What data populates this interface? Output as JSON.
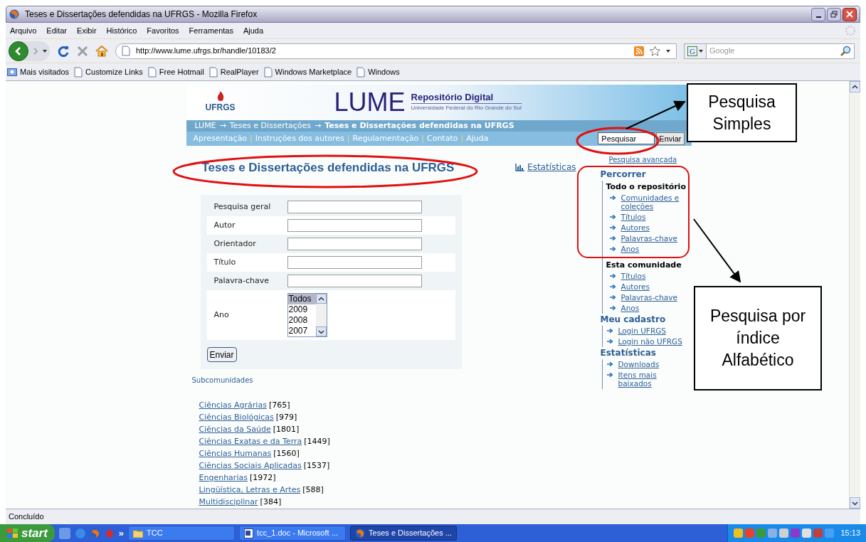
{
  "window": {
    "title": "Teses e Dissertações defendidas na UFRGS - Mozilla Firefox"
  },
  "menu": [
    "Arquivo",
    "Editar",
    "Exibir",
    "Histórico",
    "Favoritos",
    "Ferramentas",
    "Ajuda"
  ],
  "toolbar": {
    "url": "http://www.lume.ufrgs.br/handle/10183/2",
    "engine_logo": "G",
    "search_placeholder": "Google"
  },
  "bookmarks": [
    "Mais visitados",
    "Customize Links",
    "Free Hotmail",
    "RealPlayer",
    "Windows Marketplace",
    "Windows"
  ],
  "site": {
    "logo": "UFRGS",
    "brand": "LUME",
    "brand_title": "Repositório Digital",
    "brand_subtitle": "Universidade Federal do Rio Grande do Sul",
    "breadcrumb": [
      {
        "label": "LUME",
        "current": false
      },
      {
        "label": "Teses e Dissertações",
        "current": false
      },
      {
        "label": "Teses e Dissertações defendidas na UFRGS",
        "current": true
      }
    ],
    "breadcrumb_separator": "→",
    "nav": [
      "Apresentação",
      "Instruções dos autores",
      "Regulamentação",
      "Contato",
      "Ajuda"
    ],
    "nav_separator": "|",
    "search": {
      "value": "Pesquisar",
      "button": "Enviar",
      "advanced": "Pesquisa avançada"
    }
  },
  "main": {
    "title": "Teses e Dissertações defendidas na UFRGS",
    "stats_link": "Estatísticas",
    "form": {
      "fields": [
        {
          "label": "Pesquisa geral"
        },
        {
          "label": "Autor"
        },
        {
          "label": "Orientador"
        },
        {
          "label": "Título"
        },
        {
          "label": "Palavra-chave"
        }
      ],
      "year": {
        "label": "Ano",
        "options": [
          {
            "label": "Todos",
            "selected": true
          },
          {
            "label": "2009",
            "selected": false
          },
          {
            "label": "2008",
            "selected": false
          },
          {
            "label": "2007",
            "selected": false
          }
        ]
      },
      "submit": "Enviar"
    },
    "subcommunities": {
      "heading": "Subcomunidades",
      "items": [
        {
          "name": "Ciências Agrárias",
          "count": "[765]"
        },
        {
          "name": "Ciências Biológicas",
          "count": "[979]"
        },
        {
          "name": "Ciências da Saúde",
          "count": "[1801]"
        },
        {
          "name": "Ciências Exatas e da Terra",
          "count": "[1449]"
        },
        {
          "name": "Ciências Humanas",
          "count": "[1560]"
        },
        {
          "name": "Ciências Sociais Aplicadas",
          "count": "[1537]"
        },
        {
          "name": "Engenharias",
          "count": "[1972]"
        },
        {
          "name": "Lingüística, Letras e Artes",
          "count": "[588]"
        },
        {
          "name": "Multidisciplinar",
          "count": "[384]"
        }
      ]
    }
  },
  "sidebar": [
    {
      "title": "Percorrer",
      "groups": [
        {
          "title": "Todo o repositório",
          "links": [
            "Comunidades e coleções",
            "Títulos",
            "Autores",
            "Palavras-chave",
            "Anos"
          ]
        },
        {
          "title": "Esta comunidade",
          "links": [
            "Títulos",
            "Autores",
            "Palavras-chave",
            "Anos"
          ]
        }
      ]
    },
    {
      "title": "Meu cadastro",
      "groups": [
        {
          "links": [
            "Login UFRGS",
            "Login não UFRGS"
          ]
        }
      ]
    },
    {
      "title": "Estatísticas",
      "groups": [
        {
          "links": [
            "Downloads",
            "Itens mais baixados"
          ]
        }
      ]
    }
  ],
  "status_bar": "Concluído",
  "taskbar": {
    "start": "start",
    "quicklaunch_more": "»",
    "tasks": [
      {
        "label": "TCC",
        "kind": "folder",
        "selected": false
      },
      {
        "label": "tcc_1.doc - Microsoft ...",
        "kind": "word",
        "selected": false
      },
      {
        "label": "Teses e Dissertações ...",
        "kind": "firefox",
        "selected": true
      }
    ],
    "clock": "15:13"
  },
  "annotations": [
    {
      "text": "Pesquisa Simples"
    },
    {
      "text": "Pesquisa por índice Alfabético"
    }
  ]
}
